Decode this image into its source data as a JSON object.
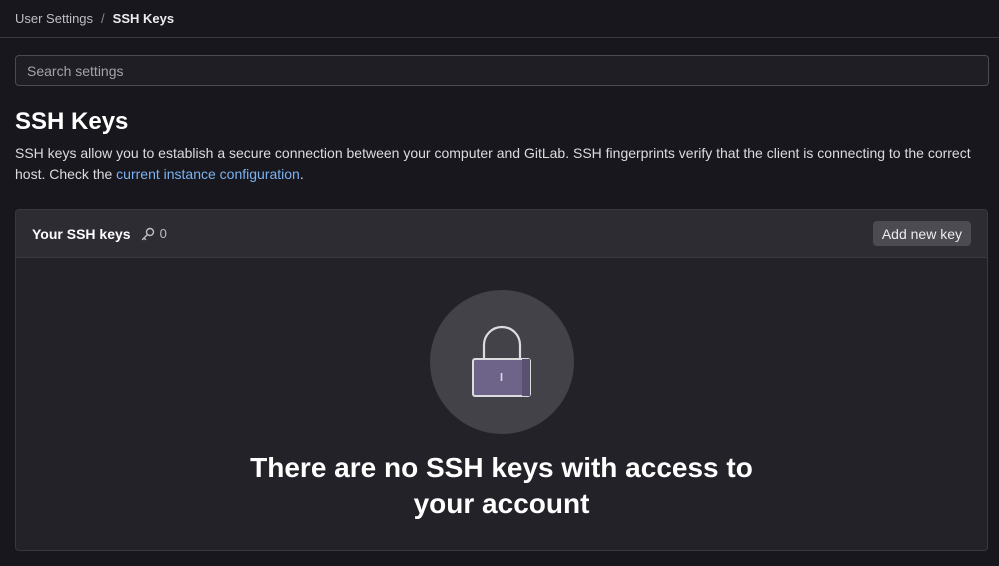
{
  "breadcrumb": {
    "parent": "User Settings",
    "separator": "/",
    "current": "SSH Keys"
  },
  "search": {
    "placeholder": "Search settings",
    "value": ""
  },
  "page": {
    "title": "SSH Keys",
    "description_text": "SSH keys allow you to establish a secure connection between your computer and GitLab. SSH fingerprints verify that the client is connecting to the correct host. Check the ",
    "description_link": "current instance configuration",
    "description_end": "."
  },
  "card": {
    "title": "Your SSH keys",
    "key_icon": "key-icon",
    "count": "0",
    "add_button": "Add new key"
  },
  "empty_state": {
    "icon": "lock-icon",
    "title": "There are no SSH keys with access to your account"
  },
  "colors": {
    "background": "#18171d",
    "card": "#232228",
    "card_header": "#2d2c32",
    "link": "#7bb2f0",
    "button": "#4c4b51",
    "lock_body": "#6e6389"
  }
}
